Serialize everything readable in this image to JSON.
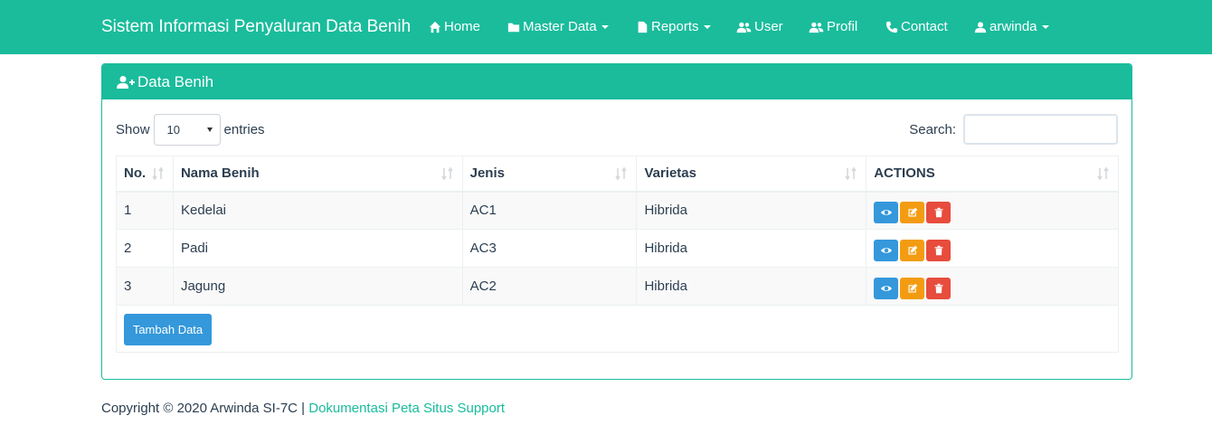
{
  "navbar": {
    "brand": "Sistem Informasi Penyaluran Data Benih",
    "items": [
      {
        "label": "Home",
        "icon": "home-icon",
        "dropdown": false
      },
      {
        "label": "Master Data",
        "icon": "folder-icon",
        "dropdown": true
      },
      {
        "label": "Reports",
        "icon": "file-icon",
        "dropdown": true
      },
      {
        "label": "User",
        "icon": "users-icon",
        "dropdown": false
      },
      {
        "label": "Profil",
        "icon": "users-icon",
        "dropdown": false
      },
      {
        "label": "Contact",
        "icon": "phone-icon",
        "dropdown": false
      },
      {
        "label": "arwinda",
        "icon": "user-icon",
        "dropdown": true
      }
    ],
    "bg_color": "#1abc9c"
  },
  "panel": {
    "title": "Data Benih",
    "icon": "user-plus-icon"
  },
  "length_control": {
    "show_label": "Show",
    "value": "10",
    "entries_label": "entries"
  },
  "search": {
    "label": "Search:",
    "value": ""
  },
  "table": {
    "headers": [
      "No.",
      "Nama Benih",
      "Jenis",
      "Varietas",
      "ACTIONS"
    ],
    "rows": [
      {
        "no": "1",
        "nama": "Kedelai",
        "jenis": "AC1",
        "varietas": "Hibrida"
      },
      {
        "no": "2",
        "nama": "Padi",
        "jenis": "AC3",
        "varietas": "Hibrida"
      },
      {
        "no": "3",
        "nama": "Jagung",
        "jenis": "AC2",
        "varietas": "Hibrida"
      }
    ],
    "action_colors": {
      "view": "#3498db",
      "edit": "#f39c12",
      "delete": "#e74c3c"
    }
  },
  "add_button": {
    "label": "Tambah Data"
  },
  "footer": {
    "copyright": "Copyright © 2020 Arwinda SI-7C | ",
    "links": "Dokumentasi Peta Situs Support"
  }
}
